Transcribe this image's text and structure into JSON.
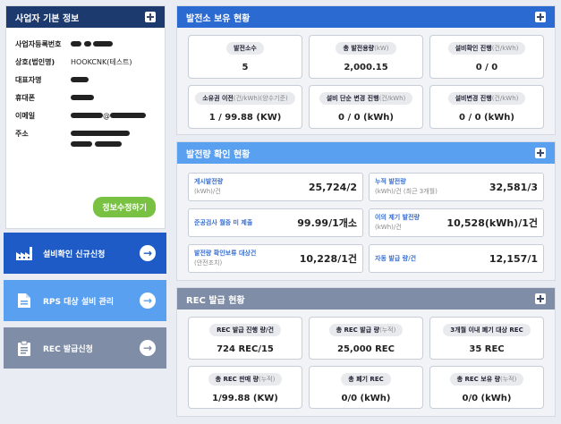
{
  "user_panel": {
    "title": "사업자 기본 정보",
    "fields": [
      {
        "label": "사업자등록번호",
        "value": ""
      },
      {
        "label": "상호(법인명)",
        "value": "HOOKCNK(테스트)"
      },
      {
        "label": "대표자명",
        "value": ""
      },
      {
        "label": "휴대폰",
        "value": ""
      },
      {
        "label": "이메일",
        "value": "@"
      },
      {
        "label": "주소",
        "value": ""
      }
    ],
    "edit_button": "정보수정하기"
  },
  "nav": [
    {
      "label": "설비확인 신규신청",
      "icon": "factory-icon",
      "color": "#1e5bc6"
    },
    {
      "label": "RPS 대상 설비 관리",
      "icon": "document-icon",
      "color": "#5aa0f0"
    },
    {
      "label": "REC 발급신청",
      "icon": "clipboard-icon",
      "color": "#7f8da6"
    }
  ],
  "plant_panel": {
    "title": "발전소 보유 현황",
    "cards": [
      {
        "label": "발전소수",
        "sub": "",
        "value": "5"
      },
      {
        "label": "총 발전용량",
        "sub": "(kW)",
        "value": "2,000.15"
      },
      {
        "label": "설비확인 진행",
        "sub": "(건/kWh)",
        "value": "0 / 0"
      },
      {
        "label": "소유권 이전",
        "sub": "(건/kWh)(양수기준)",
        "value": "1 / 99.88 (KW)"
      },
      {
        "label": "설비 단순 변경 진행",
        "sub": "(건/kWh)",
        "value": "0 / 0 (kWh)"
      },
      {
        "label": "설비변경 진행",
        "sub": "(건/kWh)",
        "value": "0 / 0 (kWh)"
      }
    ]
  },
  "gen_panel": {
    "title": "발전량 확인 현황",
    "cards": [
      {
        "label": "게시발전량",
        "sub": "(kWh)/건",
        "value": "25,724/2"
      },
      {
        "label": "누적 발전량",
        "sub": "(kWh)/건 (최근 3개월)",
        "value": "32,581/3"
      },
      {
        "label": "준공검사 월중 미 제출",
        "sub": "",
        "value": "99.99/1개소"
      },
      {
        "label": "이의 제기 발전량",
        "sub": "(kWh)/건",
        "value": "10,528(kWh)/1건"
      },
      {
        "label": "발전량 확인보류 대상건",
        "sub": "(안전조치)",
        "value": "10,228/1건"
      },
      {
        "label": "자동 발급 량/건",
        "sub": "",
        "value": "12,157/1"
      }
    ]
  },
  "rec_panel": {
    "title": "REC 발급 현황",
    "cards": [
      {
        "label": "REC 발급 진행 량/건",
        "sub": "",
        "value": "724 REC/15"
      },
      {
        "label": "총 REC 발급 량",
        "sub": "(누적)",
        "value": "25,000 REC"
      },
      {
        "label": "3개월 이내 폐기 대상 REC",
        "sub": "",
        "value": "35 REC"
      },
      {
        "label": "총 REC 판매 량",
        "sub": "(누적)",
        "value": "1/99.88 (KW)"
      },
      {
        "label": "총 폐기 REC",
        "sub": "",
        "value": "0/0 (kWh)"
      },
      {
        "label": "총 REC 보유 량",
        "sub": "(누적)",
        "value": "0/0 (kWh)"
      }
    ]
  }
}
